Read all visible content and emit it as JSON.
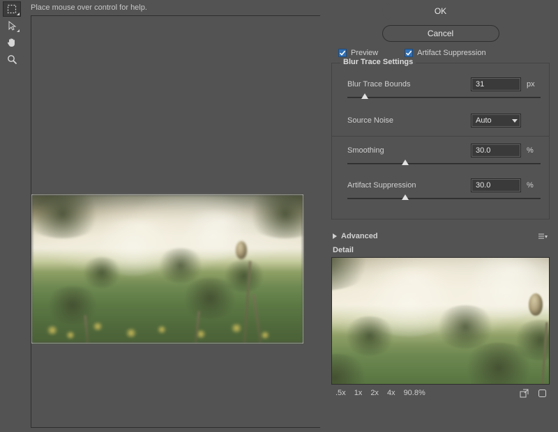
{
  "hint": "Place mouse over control for help.",
  "buttons": {
    "ok": "OK",
    "cancel": "Cancel"
  },
  "checks": {
    "preview": "Preview",
    "artifact_suppression": "Artifact Suppression"
  },
  "fieldset": {
    "title": "Blur Trace Settings",
    "blur_trace_bounds": {
      "label": "Blur Trace Bounds",
      "value": "31",
      "unit": "px",
      "slider_pct": 9
    },
    "source_noise": {
      "label": "Source Noise",
      "value": "Auto"
    },
    "smoothing": {
      "label": "Smoothing",
      "value": "30.0",
      "unit": "%",
      "slider_pct": 30
    },
    "artifact_suppression": {
      "label": "Artifact Suppression",
      "value": "30.0",
      "unit": "%",
      "slider_pct": 30
    }
  },
  "advanced": {
    "label": "Advanced"
  },
  "detail": {
    "label": "Detail",
    "zoom": {
      "levels": [
        ".5x",
        "1x",
        "2x",
        "4x"
      ],
      "percent": "90.8%"
    }
  }
}
